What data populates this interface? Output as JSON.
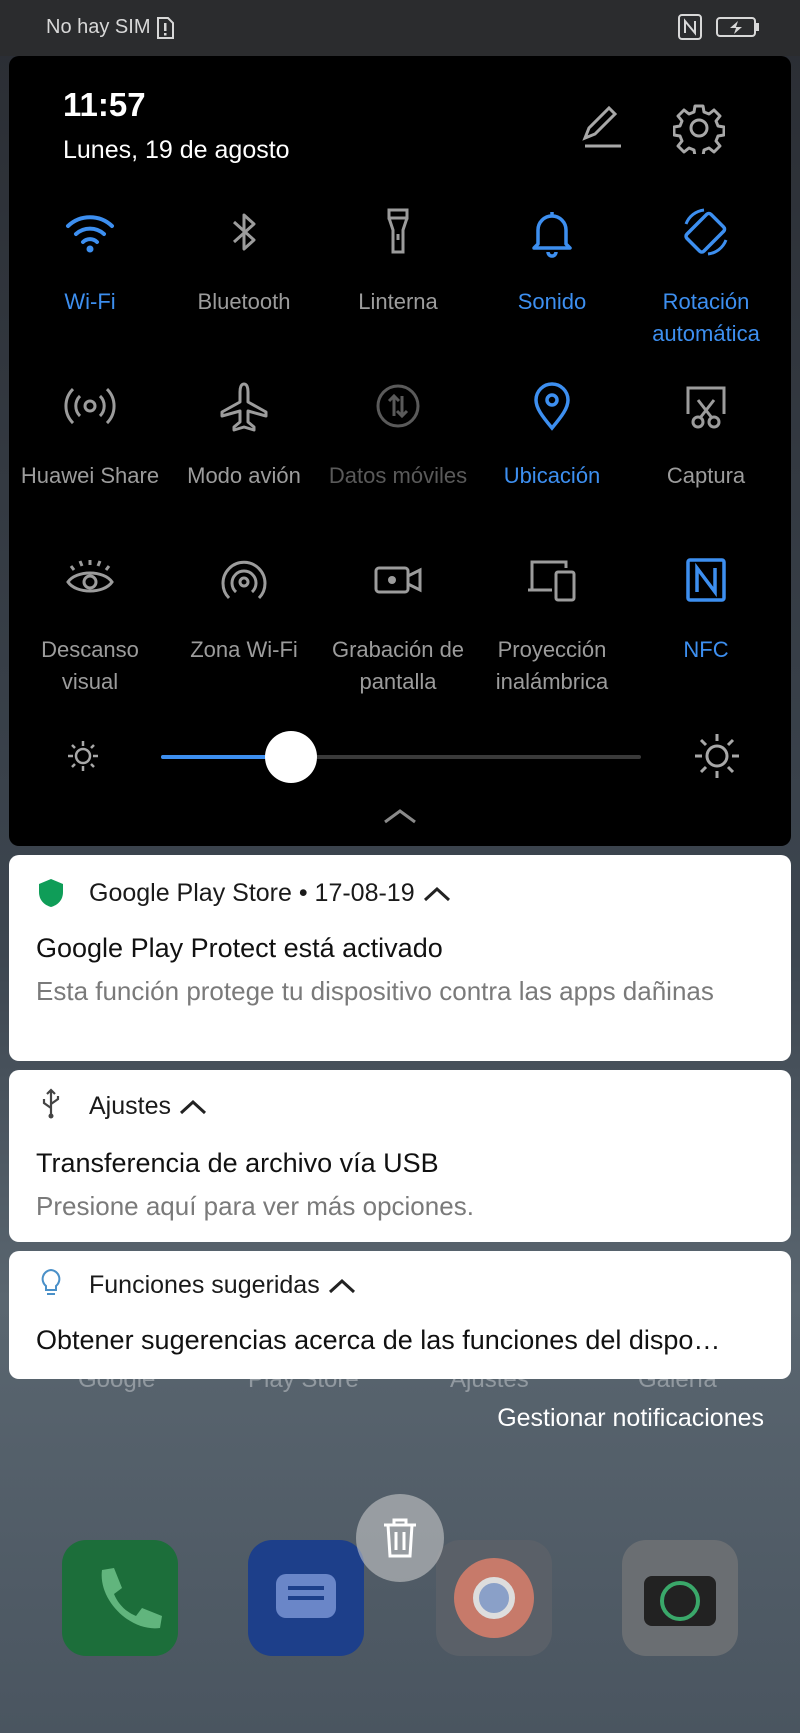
{
  "status_bar": {
    "carrier": "No hay SIM"
  },
  "quick_settings": {
    "time": "11:57",
    "date": "Lunes, 19 de agosto",
    "tiles": [
      {
        "label": "Wi-Fi",
        "icon": "wifi-icon",
        "state": "on"
      },
      {
        "label": "Bluetooth",
        "icon": "bluetooth-icon",
        "state": "off"
      },
      {
        "label": "Linterna",
        "icon": "flashlight-icon",
        "state": "off"
      },
      {
        "label": "Sonido",
        "icon": "bell-icon",
        "state": "on"
      },
      {
        "label": "Rotación automática",
        "icon": "auto-rotate-icon",
        "state": "on"
      },
      {
        "label": "Huawei Share",
        "icon": "huawei-share-icon",
        "state": "off"
      },
      {
        "label": "Modo avión",
        "icon": "airplane-icon",
        "state": "off"
      },
      {
        "label": "Datos móviles",
        "icon": "mobile-data-icon",
        "state": "disabled"
      },
      {
        "label": "Ubicación",
        "icon": "location-pin-icon",
        "state": "on"
      },
      {
        "label": "Captura",
        "icon": "screenshot-icon",
        "state": "off"
      },
      {
        "label": "Descanso visual",
        "icon": "eye-icon",
        "state": "off"
      },
      {
        "label": "Zona Wi-Fi",
        "icon": "hotspot-icon",
        "state": "off"
      },
      {
        "label": "Grabación de pantalla",
        "icon": "screen-record-icon",
        "state": "off"
      },
      {
        "label": "Proyección inalámbrica",
        "icon": "wireless-projection-icon",
        "state": "off"
      },
      {
        "label": "NFC",
        "icon": "nfc-icon",
        "state": "on"
      }
    ],
    "brightness_level": 0.27
  },
  "notifications": [
    {
      "app": "Google Play Store • 17-08-19",
      "title": "Google Play Protect está activado",
      "text": "Esta función protege tu dispositivo contra las apps dañinas",
      "icon": "shield-icon"
    },
    {
      "app": "Ajustes",
      "title": "Transferencia de archivo vía USB",
      "text": "Presione aquí para ver más opciones.",
      "icon": "usb-icon"
    },
    {
      "app": "Funciones sugeridas",
      "title": "Obtener sugerencias acerca de las funciones del dispo…",
      "icon": "lightbulb-icon"
    }
  ],
  "manage_label": "Gestionar notificaciones",
  "home_labels": [
    "Google",
    "Play Store",
    "Ajustes",
    "Galería"
  ],
  "colors": {
    "accent": "#3d8ff0",
    "inactive": "#9c9c9c",
    "play_protect": "#0f9d58"
  }
}
